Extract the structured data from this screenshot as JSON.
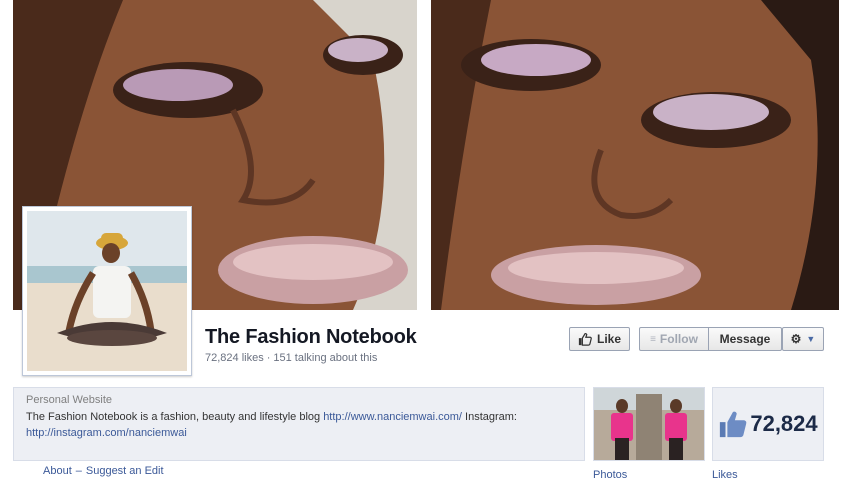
{
  "page": {
    "name": "The Fashion Notebook",
    "likes": "72,824 likes",
    "separator": "·",
    "talking": "151 talking about this"
  },
  "actions": {
    "like_label": "Like",
    "follow_label": "Follow",
    "message_label": "Message"
  },
  "about": {
    "heading": "Personal Website",
    "text_before": "The Fashion Notebook is a fashion, beauty and lifestyle blog ",
    "website_link": "http://www.nanciemwai.com/",
    "text_middle": " Instagram: ",
    "instagram_link": "http://instagram.com/nanciemwai",
    "link_about": "About",
    "link_separator": "–",
    "link_suggest": "Suggest an Edit"
  },
  "tiles": {
    "photos_label": "Photos",
    "likes_label": "Likes",
    "likes_count": "72,824"
  },
  "colors": {
    "link": "#3b5998",
    "about_bg": "#edeff4",
    "accent_pink": "#e8348c"
  },
  "icons": {
    "like": "thumbs-up-icon",
    "follow": "rss-icon",
    "settings": "gear-icon",
    "dropdown": "caret-down-icon"
  }
}
